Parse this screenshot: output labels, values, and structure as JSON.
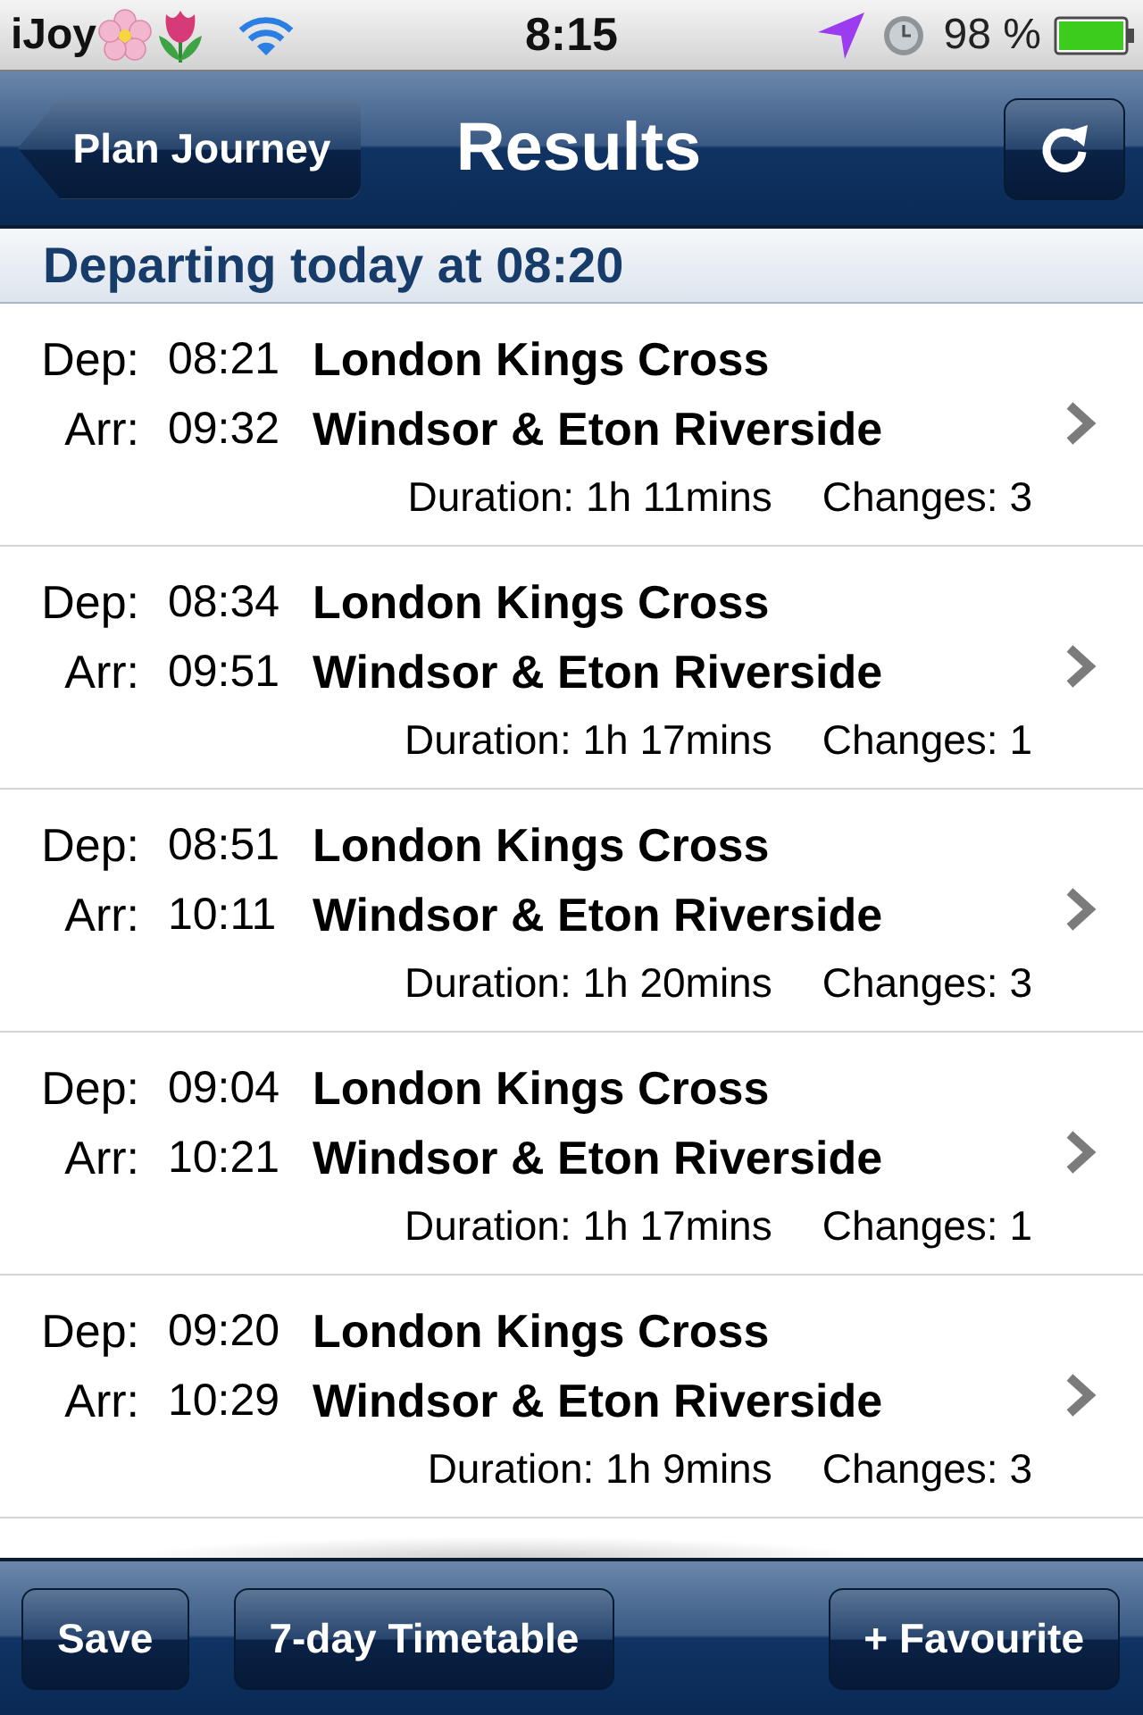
{
  "status_bar": {
    "carrier": "iJoy",
    "time": "8:15",
    "battery": "98 %"
  },
  "nav_bar": {
    "back_button": "Plan Journey",
    "title": "Results"
  },
  "section_header": "Departing today at 08:20",
  "journeys": [
    {
      "dep_label": "Dep:",
      "dep_time": "08:21",
      "origin": "London Kings Cross",
      "arr_label": "Arr:",
      "arr_time": "09:32",
      "destination": "Windsor & Eton Riverside",
      "duration": "Duration: 1h 11mins",
      "changes": "Changes: 3"
    },
    {
      "dep_label": "Dep:",
      "dep_time": "08:34",
      "origin": "London Kings Cross",
      "arr_label": "Arr:",
      "arr_time": "09:51",
      "destination": "Windsor & Eton Riverside",
      "duration": "Duration: 1h 17mins",
      "changes": "Changes: 1"
    },
    {
      "dep_label": "Dep:",
      "dep_time": "08:51",
      "origin": "London Kings Cross",
      "arr_label": "Arr:",
      "arr_time": "10:11",
      "destination": "Windsor & Eton Riverside",
      "duration": "Duration: 1h 20mins",
      "changes": "Changes: 3"
    },
    {
      "dep_label": "Dep:",
      "dep_time": "09:04",
      "origin": "London Kings Cross",
      "arr_label": "Arr:",
      "arr_time": "10:21",
      "destination": "Windsor & Eton Riverside",
      "duration": "Duration: 1h 17mins",
      "changes": "Changes: 1"
    },
    {
      "dep_label": "Dep:",
      "dep_time": "09:20",
      "origin": "London Kings Cross",
      "arr_label": "Arr:",
      "arr_time": "10:29",
      "destination": "Windsor & Eton Riverside",
      "duration": "Duration: 1h 9mins",
      "changes": "Changes: 3"
    }
  ],
  "toolbar": {
    "buttons": [
      "Save",
      "7-day Timetable",
      "+ Favourite"
    ]
  }
}
